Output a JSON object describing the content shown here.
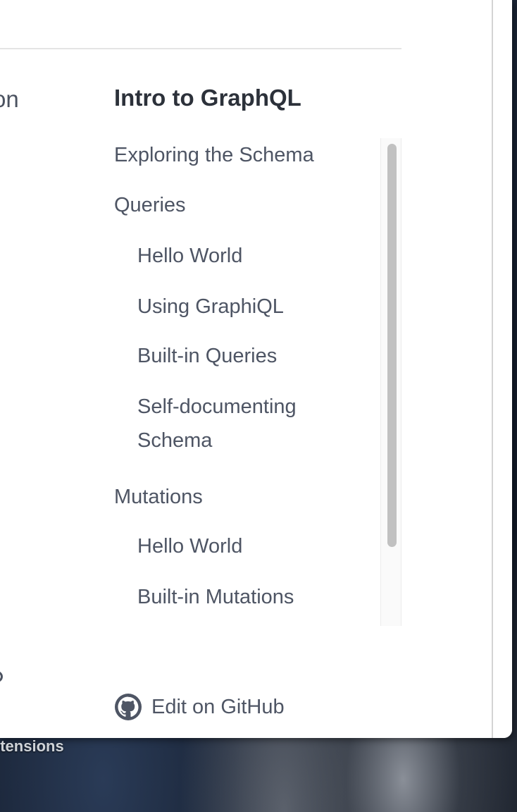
{
  "sidebar_left": {
    "cut_text": "on"
  },
  "toc": {
    "title": "Intro to GraphQL",
    "items": [
      {
        "label": "Exploring the Schema",
        "level": "top"
      },
      {
        "label": "Queries",
        "level": "top"
      },
      {
        "label": "Hello World",
        "level": "sub"
      },
      {
        "label": "Using GraphiQL",
        "level": "sub"
      },
      {
        "label": "Built-in Queries",
        "level": "sub"
      },
      {
        "label": "Self-documenting",
        "level": "sub"
      },
      {
        "label": "Schema",
        "level": "sub"
      },
      {
        "label": "Mutations",
        "level": "top"
      },
      {
        "label": "Hello World",
        "level": "sub"
      },
      {
        "label": "Built-in Mutations",
        "level": "sub"
      }
    ]
  },
  "footer": {
    "edit_label": "Edit on GitHub",
    "edit_icon": "github-icon"
  },
  "desktop": {
    "dock_label": "xtensions"
  },
  "colors": {
    "text": "#4e5564",
    "title": "#2c313a",
    "scroll_thumb": "#c1c1c1"
  }
}
